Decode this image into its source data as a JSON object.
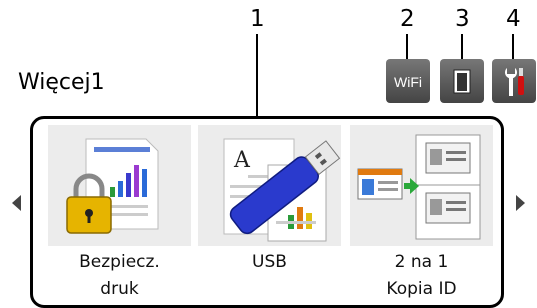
{
  "callouts": [
    "1",
    "2",
    "3",
    "4"
  ],
  "screen": {
    "title": "Więcej1"
  },
  "status_icons": [
    {
      "name": "wifi",
      "label": "WiFi"
    },
    {
      "name": "toner",
      "label": ""
    },
    {
      "name": "settings",
      "label": ""
    }
  ],
  "tiles": [
    {
      "id": "secure-print",
      "line1": "Bezpiecz.",
      "line2": "druk"
    },
    {
      "id": "usb",
      "line1": "USB",
      "line2": ""
    },
    {
      "id": "id-copy",
      "line1": "2 na 1",
      "line2": "Kopia ID"
    }
  ],
  "colors": {
    "status_icon_bg": "#555555",
    "tray_border": "#000000",
    "tile_bg": "#ececec"
  }
}
